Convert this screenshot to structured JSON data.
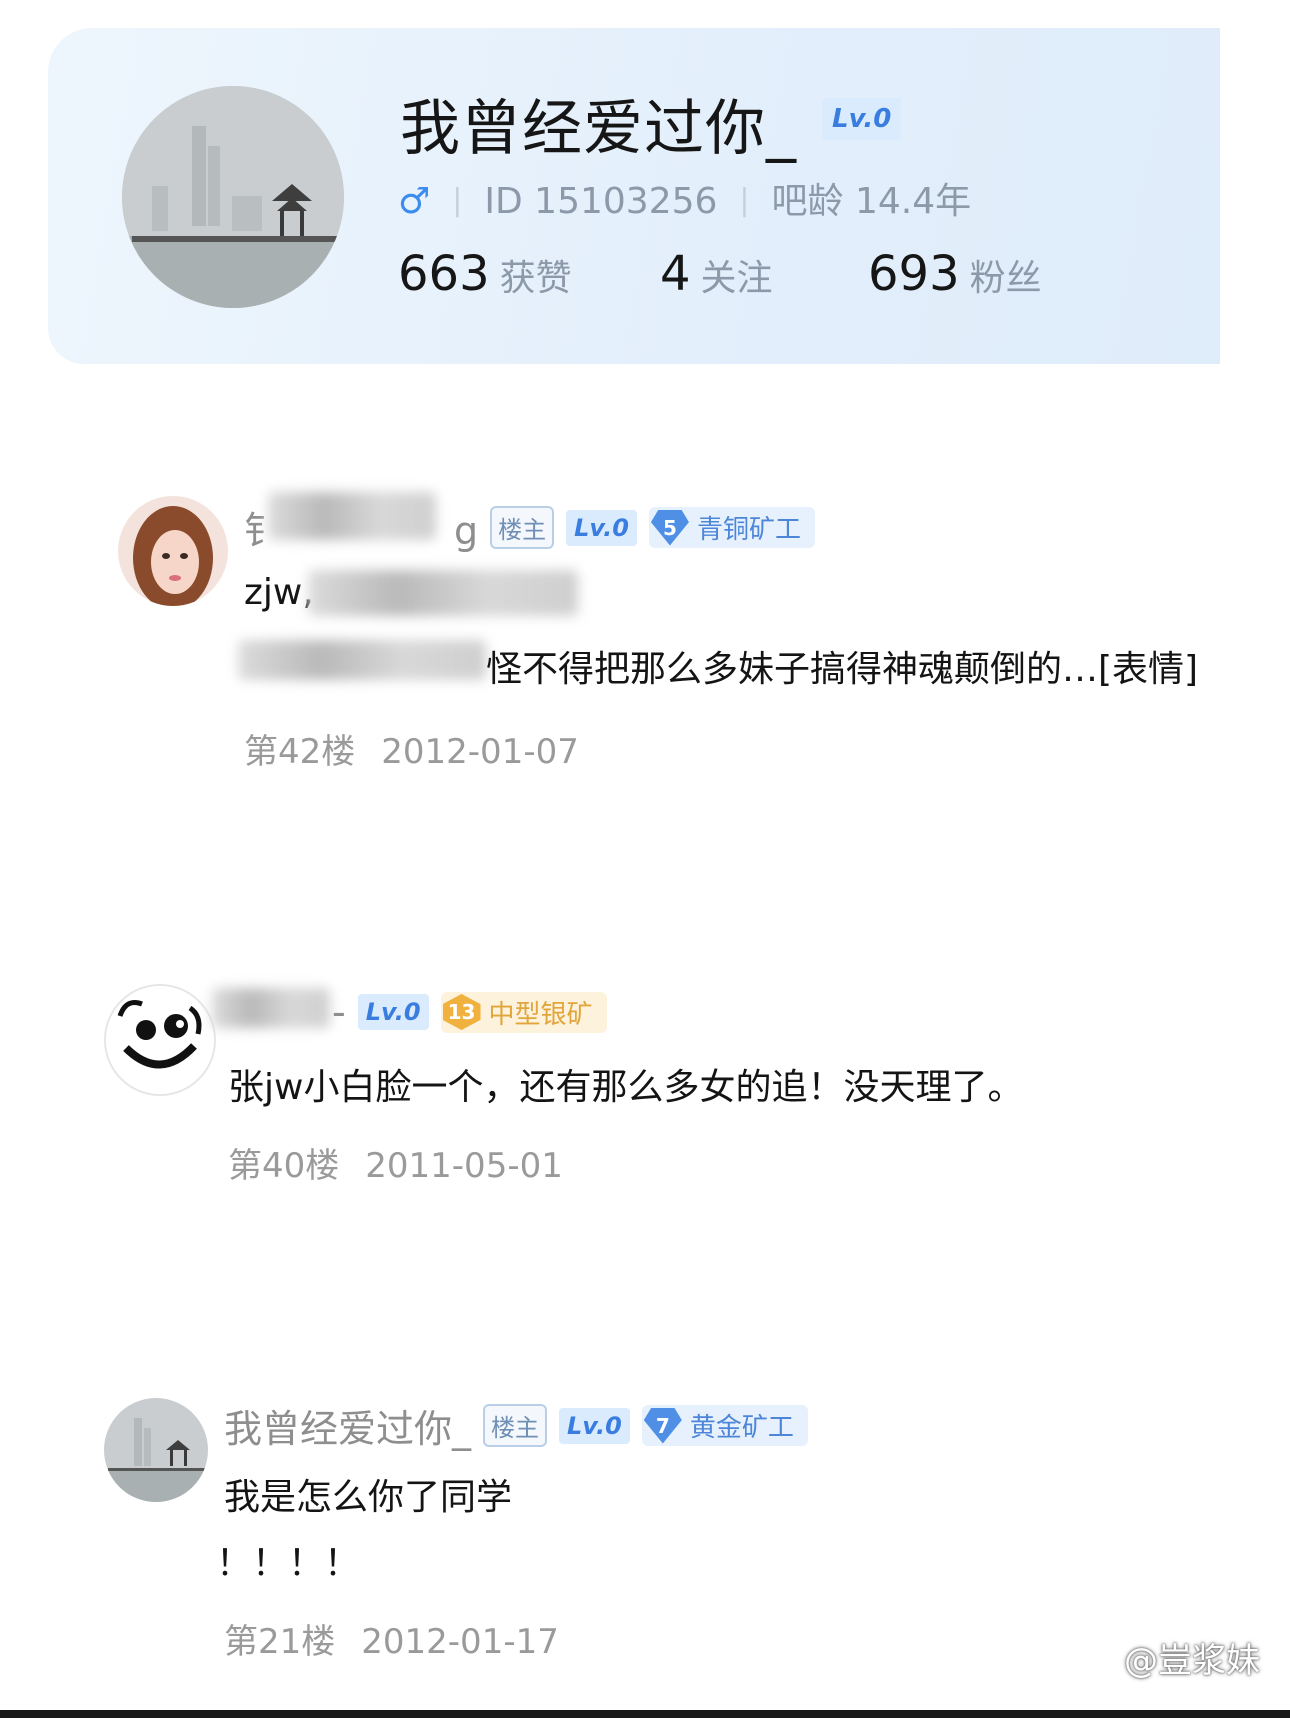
{
  "profile": {
    "name": "我曾经爱过你_",
    "level": "Lv.0",
    "gender_symbol": "♂",
    "id_text": "ID 15103256",
    "age_text": "吧龄 14.4年",
    "stats": [
      {
        "value": "663",
        "label": "获赞"
      },
      {
        "value": "4",
        "label": "关注"
      },
      {
        "value": "693",
        "label": "粉丝"
      }
    ]
  },
  "posts": [
    {
      "username_start": "钅",
      "username_end": "g",
      "owner_tag": "楼主",
      "level": "Lv.0",
      "medal_number": "5",
      "medal_label": "青铜矿工",
      "line1_visible": "zjw,",
      "line2_visible": "怪不得把那么多妹子搞得神魂颠倒的…[表情]",
      "floor": "第42楼",
      "date": "2012-01-07"
    },
    {
      "username_end": "-",
      "level": "Lv.0",
      "medal_number": "13",
      "medal_label": "中型银矿",
      "text": "张jw小白脸一个，还有那么多女的追！没天理了。",
      "floor": "第40楼",
      "date": "2011-05-01"
    },
    {
      "username": "我曾经爱过你_",
      "owner_tag": "楼主",
      "level": "Lv.0",
      "medal_number": "7",
      "medal_label": "黄金矿工",
      "line1": "我是怎么你了同学",
      "line2": "！！！！",
      "floor": "第21楼",
      "date": "2012-01-17"
    }
  ],
  "watermark": "@豈浆妹"
}
